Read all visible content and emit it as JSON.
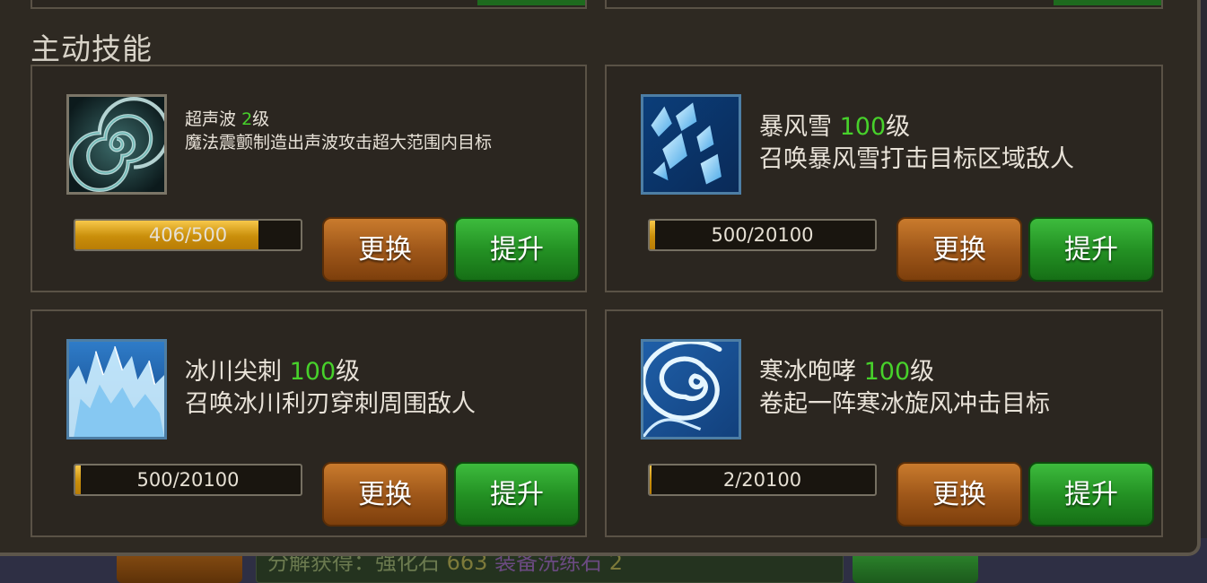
{
  "section_title": "主动技能",
  "skills": [
    {
      "name": "超声波",
      "level": "2",
      "level_suffix": "级",
      "desc": "魔法震颤制造出声波攻击超大范围内目标",
      "progress_text": "406/500",
      "progress_fraction": 0.812,
      "swap_label": "更换",
      "upgrade_label": "提升",
      "icon": "sonic-wave-icon"
    },
    {
      "name": "暴风雪",
      "level": "100",
      "level_suffix": "级",
      "desc": "召唤暴风雪打击目标区域敌人",
      "progress_text": "500/20100",
      "progress_fraction": 0.025,
      "swap_label": "更换",
      "upgrade_label": "提升",
      "icon": "blizzard-icon"
    },
    {
      "name": "冰川尖刺",
      "level": "100",
      "level_suffix": "级",
      "desc": "召唤冰川利刃穿刺周围敌人",
      "progress_text": "500/20100",
      "progress_fraction": 0.025,
      "swap_label": "更换",
      "upgrade_label": "提升",
      "icon": "glacier-spike-icon"
    },
    {
      "name": "寒冰咆哮",
      "level": "100",
      "level_suffix": "级",
      "desc": "卷起一阵寒冰旋风冲击目标",
      "progress_text": "2/20100",
      "progress_fraction": 0.0001,
      "swap_label": "更换",
      "upgrade_label": "提升",
      "icon": "frost-roar-icon"
    }
  ],
  "bottom": {
    "text_prefix": "分解获得：强化石",
    "text_value": "663",
    "text_tail": "装备洗练石",
    "text_tail_value": "2"
  },
  "colors": {
    "level": "#47d12b",
    "progress_fill": "#e0a520",
    "swap_button": "#a0581a",
    "upgrade_button": "#249224"
  }
}
